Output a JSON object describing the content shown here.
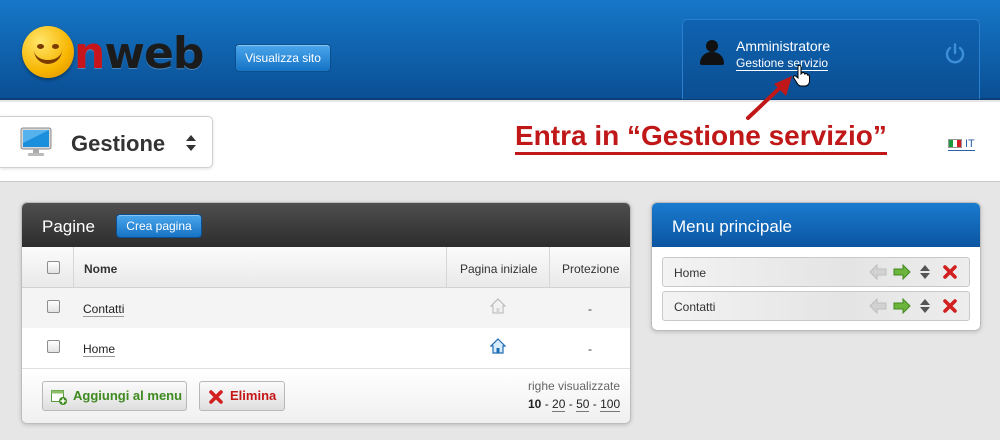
{
  "header": {
    "logo_text_n": "n",
    "logo_text_rest": "web",
    "view_site_label": "Visualizza sito",
    "user_name": "Amministratore",
    "user_link": "Gestione servizio",
    "icons": [
      "user-avatar-icon",
      "power-icon",
      "hand-cursor-icon"
    ]
  },
  "subheader": {
    "section_title": "Gestione",
    "annotation": "Entra in “Gestione servizio”",
    "language": "IT",
    "colors": {
      "annotation": "#c01818"
    }
  },
  "pages_panel": {
    "title": "Pagine",
    "create_label": "Crea pagina",
    "columns": [
      "Nome",
      "Pagina iniziale",
      "Protezione"
    ],
    "rows": [
      {
        "name": "Contatti",
        "home_active": false,
        "protection": "-"
      },
      {
        "name": "Home",
        "home_active": true,
        "protection": "-"
      }
    ],
    "add_to_menu_label": "Aggiungi al menu",
    "delete_label": "Elimina",
    "rows_shown_label": "righe visualizzate",
    "rows_options": [
      "10",
      "20",
      "50",
      "100"
    ],
    "rows_selected": "10"
  },
  "menu_panel": {
    "title": "Menu principale",
    "items": [
      {
        "label": "Home"
      },
      {
        "label": "Contatti"
      }
    ]
  },
  "colors": {
    "header_blue": "#0a4f94",
    "accent_blue": "#1673c5",
    "add_green": "#3d8a1e",
    "delete_red": "#c41616"
  }
}
